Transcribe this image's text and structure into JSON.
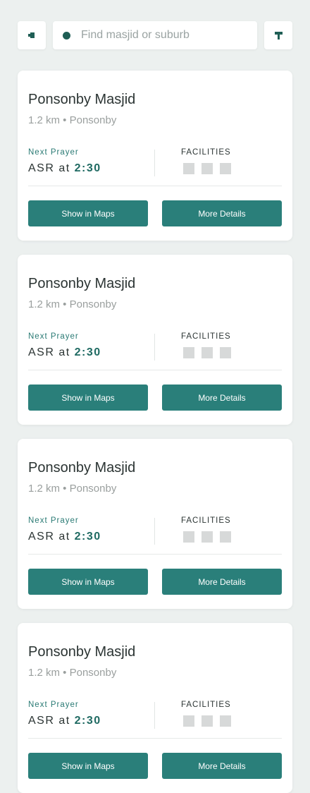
{
  "search": {
    "placeholder": "Find masjid or suburb"
  },
  "colors": {
    "accent": "#2a7f7a",
    "accent_dark": "#1f6a62",
    "background": "#ecf0ef",
    "card": "#ffffff"
  },
  "icons": {
    "left": "back-icon",
    "search": "search-icon",
    "right": "filter-icon"
  },
  "cards": [
    {
      "name": "Ponsonby Masjid",
      "meta": "1.2 km • Ponsonby",
      "next_prayer_label": "Next Prayer",
      "prayer": "ASR",
      "at": "at",
      "time": "2:30",
      "facilities_label": "FACILITIES",
      "show_maps_label": "Show in Maps",
      "more_details_label": "More Details"
    },
    {
      "name": "Ponsonby Masjid",
      "meta": "1.2 km • Ponsonby",
      "next_prayer_label": "Next Prayer",
      "prayer": "ASR",
      "at": "at",
      "time": "2:30",
      "facilities_label": "FACILITIES",
      "show_maps_label": "Show in Maps",
      "more_details_label": "More Details"
    },
    {
      "name": "Ponsonby Masjid",
      "meta": "1.2 km • Ponsonby",
      "next_prayer_label": "Next Prayer",
      "prayer": "ASR",
      "at": "at",
      "time": "2:30",
      "facilities_label": "FACILITIES",
      "show_maps_label": "Show in Maps",
      "more_details_label": "More Details"
    },
    {
      "name": "Ponsonby Masjid",
      "meta": "1.2 km • Ponsonby",
      "next_prayer_label": "Next Prayer",
      "prayer": "ASR",
      "at": "at",
      "time": "2:30",
      "facilities_label": "FACILITIES",
      "show_maps_label": "Show in Maps",
      "more_details_label": "More Details"
    }
  ]
}
